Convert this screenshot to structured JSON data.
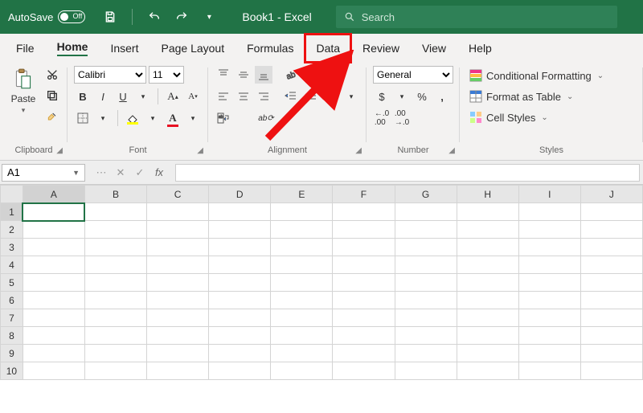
{
  "titlebar": {
    "autosave_label": "AutoSave",
    "autosave_state": "Off",
    "doc_title": "Book1  -  Excel",
    "search_placeholder": "Search"
  },
  "tabs": {
    "file": "File",
    "home": "Home",
    "insert": "Insert",
    "page_layout": "Page Layout",
    "formulas": "Formulas",
    "data": "Data",
    "review": "Review",
    "view": "View",
    "help": "Help"
  },
  "ribbon": {
    "clipboard": {
      "label": "Clipboard",
      "paste": "Paste"
    },
    "font": {
      "label": "Font",
      "font_name": "Calibri",
      "font_size": "11",
      "bold": "B",
      "italic": "I",
      "underline": "U"
    },
    "alignment": {
      "label": "Alignment"
    },
    "number": {
      "label": "Number",
      "format": "General"
    },
    "styles": {
      "label": "Styles",
      "conditional": "Conditional Formatting",
      "table": "Format as Table",
      "cell": "Cell Styles"
    }
  },
  "formula_bar": {
    "cell_ref": "A1",
    "fx": "fx"
  },
  "grid": {
    "columns": [
      "A",
      "B",
      "C",
      "D",
      "E",
      "F",
      "G",
      "H",
      "I",
      "J"
    ],
    "rows": [
      "1",
      "2",
      "3",
      "4",
      "5",
      "6",
      "7",
      "8",
      "9",
      "10"
    ],
    "selected_col": "A",
    "selected_row": "1"
  },
  "annotation": {
    "highlighted_tab": "data"
  }
}
